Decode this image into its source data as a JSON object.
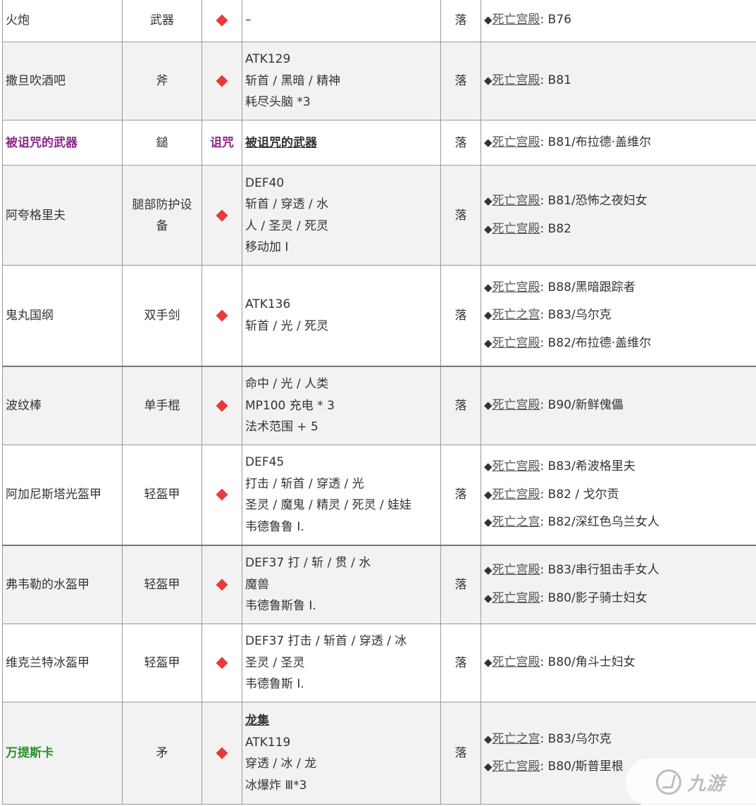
{
  "rows": [
    {
      "name": "火炮",
      "type": "武器",
      "mark": "diamond",
      "stats": [
        "–"
      ],
      "drop": "落",
      "sources": [
        {
          "loc": "死亡宫殿",
          "rest": ": B76"
        }
      ]
    },
    {
      "name": "撒旦吹酒吧",
      "type": "斧",
      "mark": "diamond",
      "stats": [
        "ATK129",
        "斩首 / 黑暗 / 精神",
        "耗尽头脑 *3"
      ],
      "drop": "落",
      "sources": [
        {
          "loc": "死亡宫殿",
          "rest": ": B81"
        }
      ]
    },
    {
      "name": "被诅咒的武器",
      "type": "鎚",
      "mark": "text",
      "mark_text": "诅咒",
      "stats_link": "被诅咒的武器",
      "drop": "落",
      "sources": [
        {
          "loc": "死亡宫殿",
          "rest": ": B81/布拉德·盖维尔"
        }
      ]
    },
    {
      "name": "阿夸格里夫",
      "type": "腿部防护设备",
      "mark": "diamond",
      "stats": [
        "DEF40",
        "斩首 / 穿透 / 水",
        "人 / 圣灵 / 死灵",
        "移动加 I"
      ],
      "drop": "落",
      "sources": [
        {
          "loc": "死亡宫殿",
          "rest": ": B81/恐怖之夜妇女"
        },
        {
          "loc": "死亡宫殿",
          "rest": ": B82"
        }
      ]
    },
    {
      "name": "鬼丸国纲",
      "type": "双手剑",
      "mark": "diamond",
      "stats": [
        "ATK136",
        "斩首 / 光 / 死灵"
      ],
      "drop": "落",
      "sources": [
        {
          "loc": "死亡宫殿",
          "rest": ": B88/黑暗跟踪者"
        },
        {
          "loc": "死亡之宫",
          "rest": ": B83/乌尔克"
        },
        {
          "loc": "死亡宫殿",
          "rest": ": B82/布拉德·盖维尔"
        }
      ]
    },
    {
      "name": "波纹棒",
      "type": "单手棍",
      "mark": "diamond",
      "stats": [
        "命中 / 光 / 人类",
        "MP100 充电 * 3",
        "法术范围 + 5"
      ],
      "drop": "落",
      "sources": [
        {
          "loc": "死亡宫殿",
          "rest": ": B90/新鲜傀儡"
        }
      ]
    },
    {
      "name": "阿加尼斯塔光盔甲",
      "type": "轻盔甲",
      "mark": "diamond",
      "stats": [
        "DEF45",
        "打击 / 斩首 / 穿透 / 光",
        "圣灵 / 魔鬼 / 精灵 / 死灵 / 娃娃",
        "韦德鲁鲁 I."
      ],
      "drop": "落",
      "sources": [
        {
          "loc": "死亡宫殿",
          "rest": ": B83/希波格里夫"
        },
        {
          "loc": "死亡宫殿",
          "rest": ": B82 / 戈尔贡"
        },
        {
          "loc": "死亡之宫",
          "rest": ": B82/深红色乌兰女人"
        }
      ]
    },
    {
      "name": "弗韦勒的水盔甲",
      "type": "轻盔甲",
      "mark": "diamond",
      "stats": [
        "DEF37 打 / 斩 / 贯 / 水",
        "魔兽",
        "韦德鲁斯鲁 I."
      ],
      "drop": "落",
      "sources": [
        {
          "loc": "死亡宫殿",
          "rest": ": B83/串行狙击手女人"
        },
        {
          "loc": "死亡宫殿",
          "rest": ": B80/影子骑士妇女"
        }
      ]
    },
    {
      "name": "维克兰特冰盔甲",
      "type": "轻盔甲",
      "mark": "diamond",
      "stats": [
        "DEF37 打击 / 斩首 / 穿透 / 冰",
        "圣灵 / 圣灵",
        "韦德鲁斯 I."
      ],
      "drop": "落",
      "sources": [
        {
          "loc": "死亡宫殿",
          "rest": ": B80/角斗士妇女"
        }
      ]
    },
    {
      "name": "万提斯卡",
      "type": "矛",
      "mark": "diamond",
      "stats_link": "龙集",
      "stats": [
        "ATK119",
        "穿透 / 冰 / 龙",
        "冰爆炸 Ⅲ*3"
      ],
      "drop": "落",
      "sources": [
        {
          "loc": "死亡之宫",
          "rest": ": B83/乌尔克"
        },
        {
          "loc": "死亡宫殿",
          "rest": ": B80/斯普里根"
        }
      ]
    }
  ],
  "watermark": {
    "text": "九游"
  }
}
